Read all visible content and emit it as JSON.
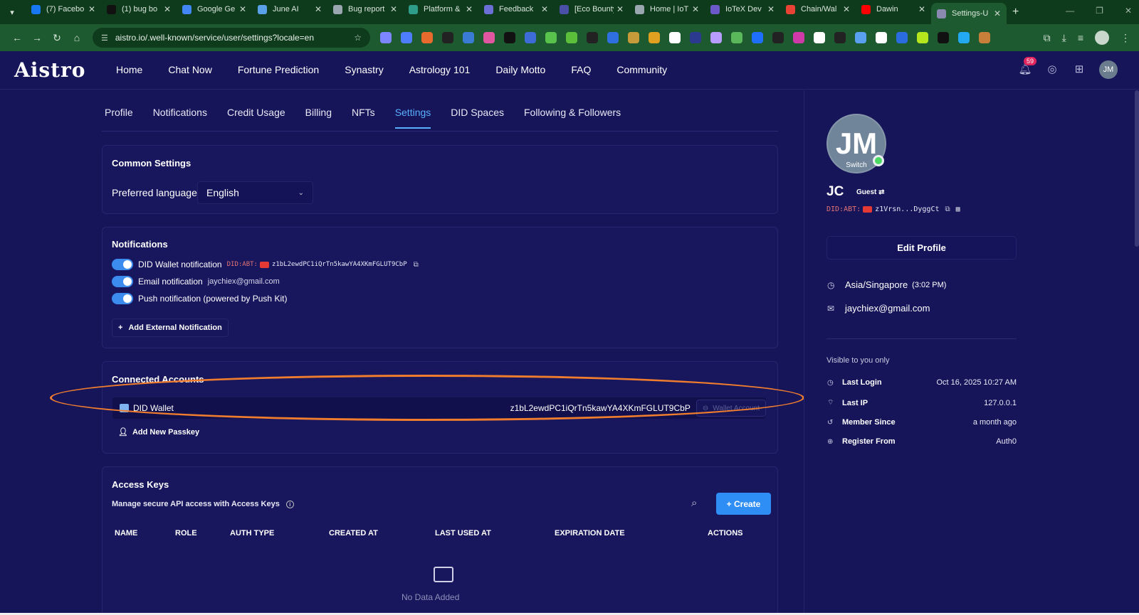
{
  "browser": {
    "tabs": [
      {
        "label": "(7) Facebo",
        "color": "#1877f2"
      },
      {
        "label": "(1) bug bo",
        "color": "#111111"
      },
      {
        "label": "Google Ge",
        "color": "#4285f4"
      },
      {
        "label": "June AI",
        "color": "#5aa0e8"
      },
      {
        "label": "Bug report",
        "color": "#9aa7b0"
      },
      {
        "label": "Platform &",
        "color": "#2e9e8b"
      },
      {
        "label": "Feedback",
        "color": "#6b6fd6"
      },
      {
        "label": "[Eco Bounty",
        "color": "#4a4fa8"
      },
      {
        "label": "Home | IoT",
        "color": "#9aa7b0"
      },
      {
        "label": "IoTeX Dev",
        "color": "#6b59c9"
      },
      {
        "label": "Chain/Wal",
        "color": "#ea4335"
      },
      {
        "label": "Dawin",
        "color": "#ff0000"
      },
      {
        "label": "Settings-U",
        "color": "#8a8ab0",
        "active": true
      }
    ],
    "url": "aistro.io/.well-known/service/user/settings?locale=en",
    "extension_colors": [
      "#7e86ff",
      "#4f7dff",
      "#e86a2c",
      "#222222",
      "#3a7bd5",
      "#e056a0",
      "#111111",
      "#3d6bd8",
      "#58c24d",
      "#5bbf3a",
      "#222222",
      "#2f6fe0",
      "#c79a3a",
      "#e0a020",
      "#ffffff",
      "#2b3a8f",
      "#b89cff",
      "#5bb85a",
      "#1f6fff",
      "#222222",
      "#d03aa8",
      "#ffffff",
      "#222222",
      "#5aa0f0",
      "#ffffff",
      "#2b6be0",
      "#b5e61d",
      "#111111",
      "#23a8f2",
      "#c87f3a"
    ]
  },
  "app": {
    "logo": "Aistro",
    "nav": [
      "Home",
      "Chat Now",
      "Fortune Prediction",
      "Synastry",
      "Astrology 101",
      "Daily Motto",
      "FAQ",
      "Community"
    ],
    "notification_count": "59",
    "avatar_initials": "JM"
  },
  "subtabs": [
    "Profile",
    "Notifications",
    "Credit Usage",
    "Billing",
    "NFTs",
    "Settings",
    "DID Spaces",
    "Following & Followers"
  ],
  "active_subtab": "Settings",
  "common": {
    "title": "Common Settings",
    "language_label": "Preferred language",
    "language_value": "English"
  },
  "notifications": {
    "title": "Notifications",
    "wallet_label": "DID Wallet notification",
    "did_prefix": "DID:ABT:",
    "did_value": "z1bL2ewdPC1iQrTn5kawYA4XKmFGLUT9CbP",
    "email_label": "Email notification",
    "email_value": "jaychiex@gmail.com",
    "push_label": "Push notification (powered by Push Kit)",
    "add_external": "Add External Notification"
  },
  "connected": {
    "title": "Connected Accounts",
    "account_name": "DID Wallet",
    "account_id": "z1bL2ewdPC1iQrTn5kawYA4XKmFGLUT9CbP",
    "wallet_account_btn": "Wallet Account",
    "add_passkey": "Add New Passkey"
  },
  "access_keys": {
    "title": "Access Keys",
    "description": "Manage secure API access with Access Keys",
    "create": "+ Create",
    "columns": [
      "NAME",
      "ROLE",
      "AUTH TYPE",
      "CREATED AT",
      "LAST USED AT",
      "EXPIRATION DATE",
      "ACTIONS"
    ],
    "empty": "No Data Added"
  },
  "profile": {
    "initials": "JM",
    "switch": "Switch",
    "name": "JC",
    "role": "Guest",
    "did_prefix": "DID:ABT:",
    "did_short": "z1Vrsn...DyggCt",
    "edit": "Edit Profile",
    "timezone": "Asia/Singapore",
    "time": "(3:02 PM)",
    "email": "jaychiex@gmail.com",
    "visible_note": "Visible to you only",
    "meta": [
      {
        "key": "Last Login",
        "value": "Oct 16, 2025 10:27 AM"
      },
      {
        "key": "Last IP",
        "value": "127.0.0.1"
      },
      {
        "key": "Member Since",
        "value": "a month ago"
      },
      {
        "key": "Register From",
        "value": "Auth0"
      }
    ]
  }
}
